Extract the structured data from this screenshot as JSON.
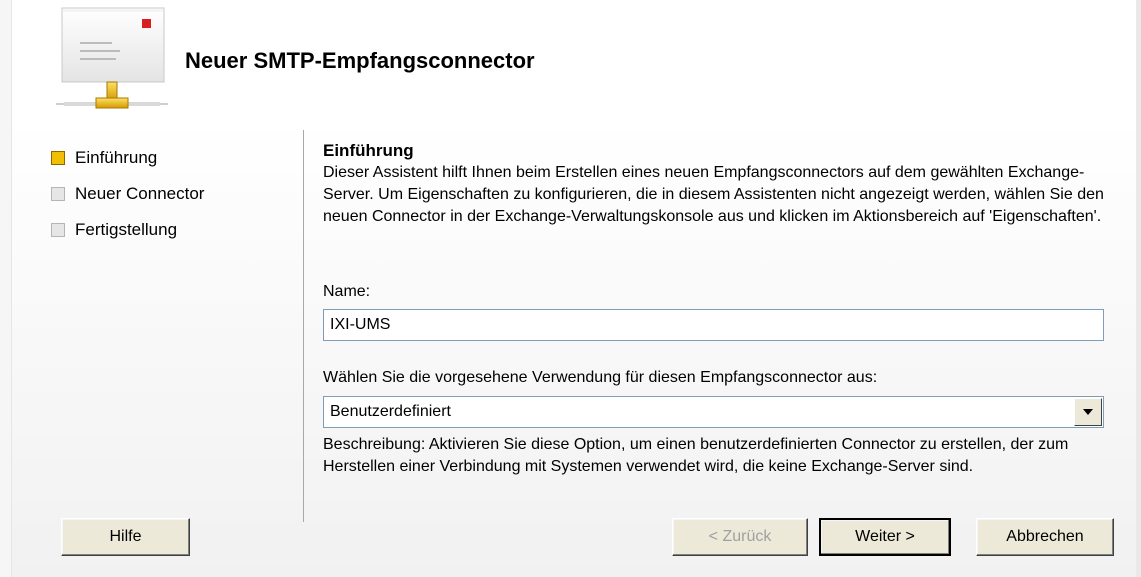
{
  "header": {
    "title": "Neuer SMTP-Empfangsconnector",
    "icon": "smtp-connector-icon"
  },
  "steps": [
    {
      "label": "Einführung",
      "state": "active"
    },
    {
      "label": "Neuer Connector",
      "state": "inactive"
    },
    {
      "label": "Fertigstellung",
      "state": "inactive"
    }
  ],
  "content": {
    "section_title": "Einführung",
    "intro": "Dieser Assistent hilft Ihnen beim Erstellen eines neuen Empfangsconnectors auf dem gewählten Exchange-Server. Um Eigenschaften zu konfigurieren, die in diesem Assistenten nicht angezeigt werden, wählen Sie den neuen Connector in der Exchange-Verwaltungskonsole aus und klicken im Aktionsbereich auf 'Eigenschaften'.",
    "name_label": "Name:",
    "name_value": "IXI-UMS",
    "usage_label": "Wählen Sie die vorgesehene Verwendung für diesen Empfangsconnector aus:",
    "usage_value": "Benutzerdefiniert",
    "description": "Beschreibung: Aktivieren Sie diese Option, um einen benutzerdefinierten Connector zu erstellen, der zum Herstellen einer Verbindung mit Systemen verwendet wird, die keine Exchange-Server sind."
  },
  "buttons": {
    "help": "Hilfe",
    "back": "< Zurück",
    "next": "Weiter >",
    "cancel": "Abbrechen"
  },
  "colors": {
    "active_step": "#f0c000",
    "inactive_step": "#e6e6e6"
  }
}
